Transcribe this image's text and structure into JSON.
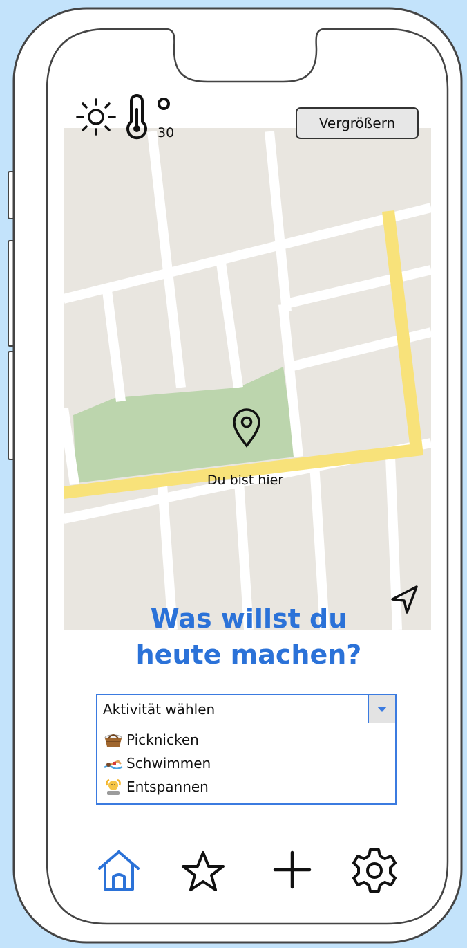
{
  "weather": {
    "condition_icon": "sun-icon",
    "thermometer_icon": "thermometer-icon",
    "temperature": "30"
  },
  "map": {
    "zoom_button_label": "Vergrößern",
    "location_label": "Du bist hier",
    "pin_icon": "map-pin-icon",
    "locate_icon": "navigation-arrow-icon",
    "colors": {
      "background": "#e9e6e0",
      "road": "#ffffff",
      "main_road": "#f8e27a",
      "park": "#bcd5ad"
    }
  },
  "headline": {
    "line1": "Was willst du",
    "line2": "heute machen?"
  },
  "activity_select": {
    "selected": "Aktivität wählen",
    "options": [
      {
        "label": "Picknicken",
        "icon": "picnic-basket-icon"
      },
      {
        "label": "Schwimmen",
        "icon": "swimmer-icon"
      },
      {
        "label": "Entspannen",
        "icon": "person-relaxing-icon"
      }
    ]
  },
  "bottom_nav": [
    {
      "icon": "home-icon",
      "active": true
    },
    {
      "icon": "star-icon",
      "active": false
    },
    {
      "icon": "plus-icon",
      "active": false
    },
    {
      "icon": "gear-icon",
      "active": false
    }
  ],
  "colors": {
    "accent": "#2b72d8",
    "page_background": "#c3e3fb"
  }
}
